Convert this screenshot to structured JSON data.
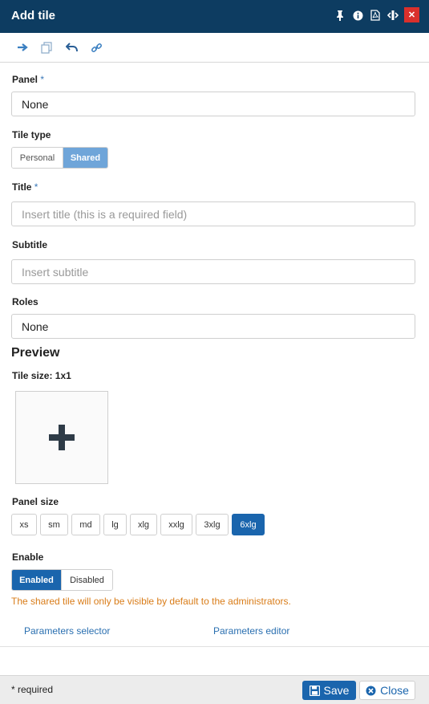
{
  "header": {
    "title": "Add tile"
  },
  "form": {
    "panel": {
      "label": "Panel",
      "required_mark": "*",
      "value": "None"
    },
    "tile_type": {
      "label": "Tile type",
      "options": [
        "Personal",
        "Shared"
      ],
      "selected": "Shared"
    },
    "title": {
      "label": "Title",
      "required_mark": "*",
      "placeholder": "Insert title (this is a required field)"
    },
    "subtitle": {
      "label": "Subtitle",
      "placeholder": "Insert subtitle"
    },
    "roles": {
      "label": "Roles",
      "value": "None"
    }
  },
  "preview": {
    "heading": "Preview",
    "tile_size_label": "Tile size: 1x1"
  },
  "panel_size": {
    "label": "Panel size",
    "options": [
      "xs",
      "sm",
      "md",
      "lg",
      "xlg",
      "xxlg",
      "3xlg",
      "6xlg"
    ],
    "selected": "6xlg"
  },
  "enable": {
    "label": "Enable",
    "options": [
      "Enabled",
      "Disabled"
    ],
    "selected": "Enabled"
  },
  "warning": "The shared tile will only be visible by default to the administrators.",
  "links": {
    "parameters_selector": "Parameters selector",
    "parameters_editor": "Parameters editor"
  },
  "footer": {
    "required_note": "* required",
    "save": "Save",
    "close": "Close"
  },
  "colors": {
    "header_bg": "#0d3c61",
    "primary": "#1a65ad",
    "segment_active": "#6fa5d9",
    "warning": "#d97c18",
    "close_red": "#d9302c"
  },
  "icons": {
    "header": [
      "pin-icon",
      "info-icon",
      "pdf-icon",
      "resize-icon",
      "close-icon"
    ],
    "toolbar": [
      "arrow-right-icon",
      "copy-icon",
      "undo-icon",
      "link-icon"
    ]
  }
}
